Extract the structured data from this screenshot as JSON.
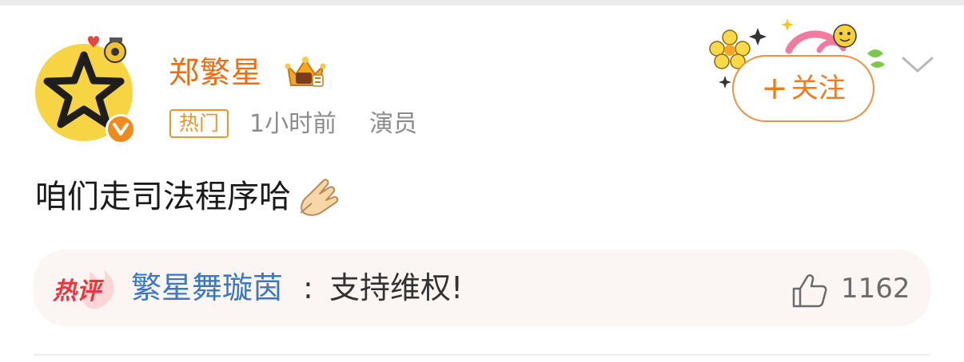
{
  "post": {
    "username": "郑繁星",
    "hot_tag": "热门",
    "timestamp": "1小时前",
    "role": "演员",
    "follow_plus": "+",
    "follow_label": "关注",
    "text": "咱们走司法程序哈",
    "emoji": "pray-hands-emoji"
  },
  "hot_comment": {
    "label": "热评",
    "commenter": "繁星舞璇茵",
    "separator": ":",
    "text": "支持维权!",
    "like_count": "1162"
  },
  "colors": {
    "username": "#f26b0f",
    "hot_tag": "#f0932e",
    "follow": "#f07b18",
    "commenter": "#3a78c7",
    "hot_label": "#f0323c",
    "avatar_bg": "#f7d443"
  }
}
